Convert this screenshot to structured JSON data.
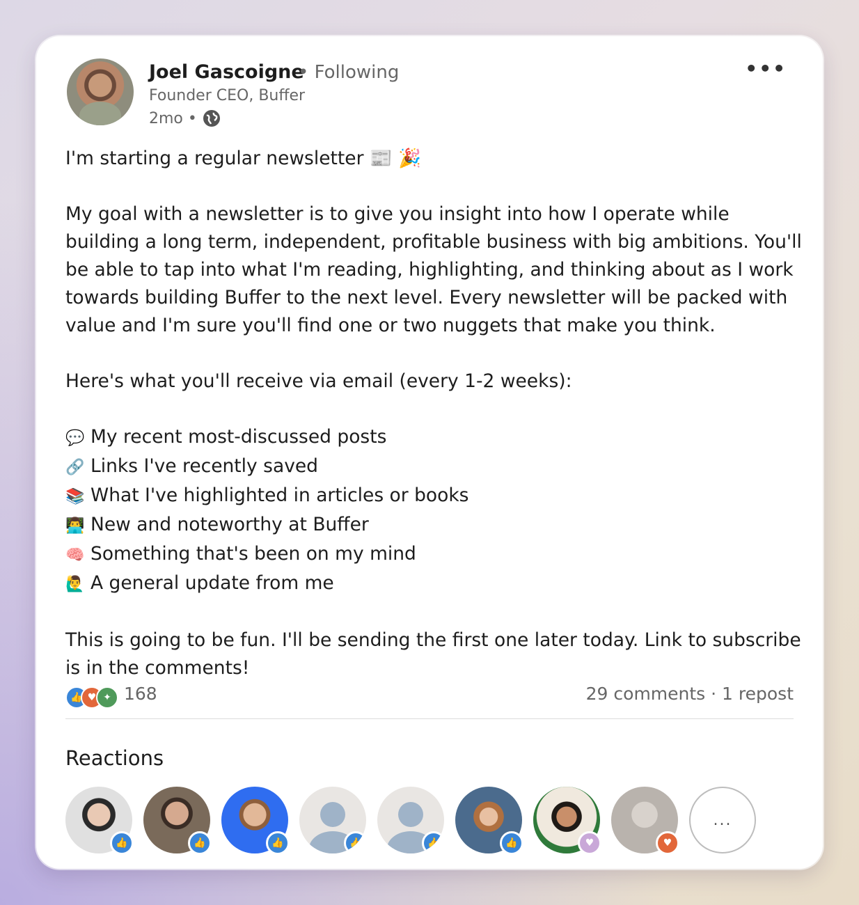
{
  "post": {
    "author": "Joel Gascoigne",
    "follow_status": "• Following",
    "headline": "Founder CEO, Buffer",
    "age": "2mo •",
    "more_label": "•••",
    "paragraphs": {
      "p1": "I'm starting a regular newsletter 📰 🎉",
      "p2": "My goal with a newsletter is to give you insight into how I operate while building a long term, independent, profitable business with big ambitions. You'll be able to tap into what I'm reading, highlighting, and thinking about as I work towards building Buffer to the next level. Every newsletter will be packed with value and I'm sure you'll find one or two nuggets that make you think.",
      "p3": "Here's what you'll receive via email (every 1-2 weeks):",
      "p4": "This is going to be fun. I'll be sending the first one later today. Link to subscribe is in the comments!"
    },
    "list": [
      {
        "emoji": "💬",
        "text": "My recent most-discussed posts"
      },
      {
        "emoji": "🔗",
        "text": "Links I've recently saved"
      },
      {
        "emoji": "📚",
        "text": "What I've highlighted in articles or books"
      },
      {
        "emoji": "👨‍💻",
        "text": "New and noteworthy at Buffer"
      },
      {
        "emoji": "🧠",
        "text": "Something that's been on my mind"
      },
      {
        "emoji": "🙋‍♂️",
        "text": "A general update from me"
      }
    ],
    "reaction_count": "168",
    "comments_reposts": "29 comments · 1 repost"
  },
  "reactions_section": {
    "title": "Reactions",
    "more_label": "..."
  },
  "colors": {
    "like": "#3a86d8",
    "love": "#e2673a",
    "support": "#c9a8d8"
  }
}
